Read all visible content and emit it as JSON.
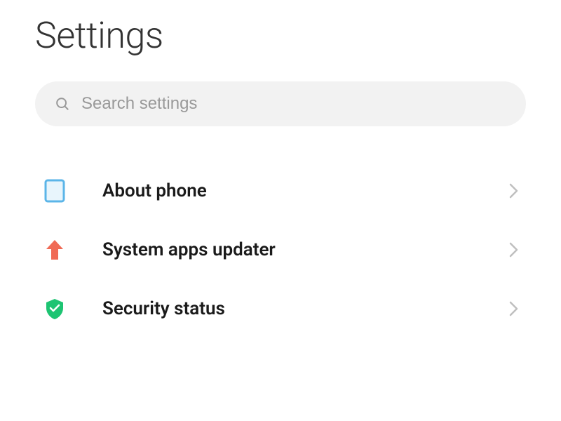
{
  "page": {
    "title": "Settings"
  },
  "search": {
    "placeholder": "Search settings"
  },
  "items": [
    {
      "icon": "phone-outline-icon",
      "label": "About phone"
    },
    {
      "icon": "arrow-up-icon",
      "label": "System apps updater"
    },
    {
      "icon": "shield-check-icon",
      "label": "Security status"
    }
  ],
  "colors": {
    "phone_icon_border": "#5bb5e8",
    "phone_icon_fill": "#e8f5fc",
    "arrow_icon": "#f06a55",
    "shield_icon": "#1dc472",
    "chevron": "#bfbfbf",
    "search_icon": "#999999"
  }
}
